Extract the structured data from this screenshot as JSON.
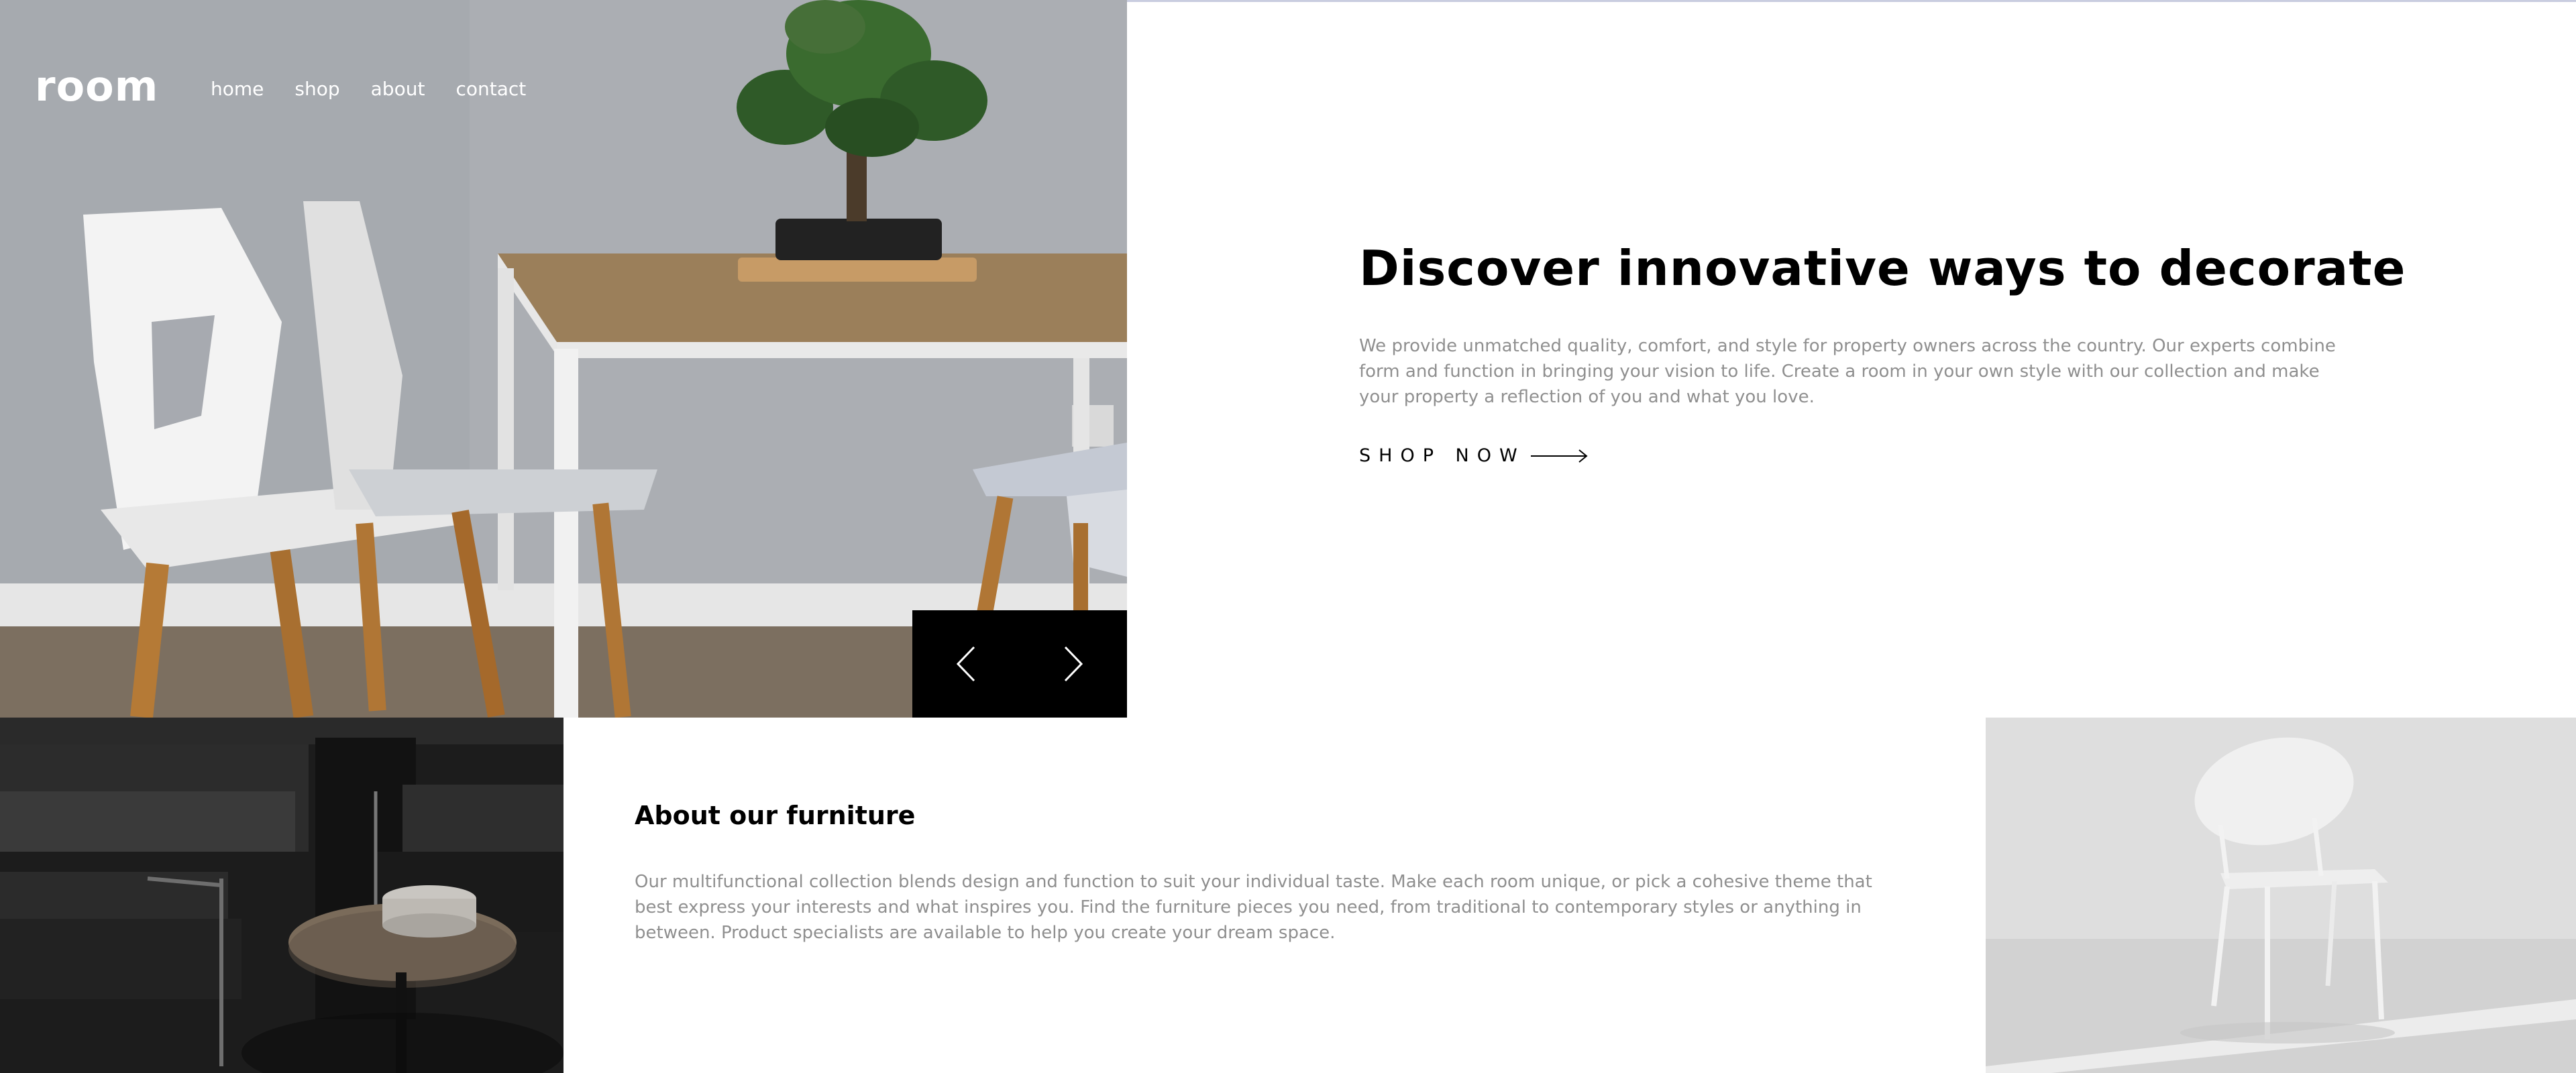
{
  "header": {
    "logo": "room",
    "nav": [
      "home",
      "shop",
      "about",
      "contact"
    ]
  },
  "hero": {
    "title": "Discover innovative ways to decorate",
    "description": "We provide unmatched quality, comfort, and style for property owners across the country. Our experts combine form and function in bringing your vision to life. Create a room in your own style with our collection and make your property a reflection of you and what you love.",
    "cta_label": "SHOP NOW",
    "cta_icon": "arrow-right-icon"
  },
  "slider": {
    "prev_icon": "chevron-left-icon",
    "next_icon": "chevron-right-icon"
  },
  "about": {
    "title": "About our furniture",
    "description": "Our multifunctional collection blends design and function to suit your individual taste. Make each room unique, or pick a cohesive theme that best express your interests and what inspires you. Find the furniture pieces you need, from traditional to contemporary styles or anything in between. Product specialists are available to help you create your dream space."
  },
  "colors": {
    "text_primary": "#000000",
    "text_muted": "#8f8f8f",
    "slider_bg": "#000000",
    "nav_text": "#ffffff"
  }
}
